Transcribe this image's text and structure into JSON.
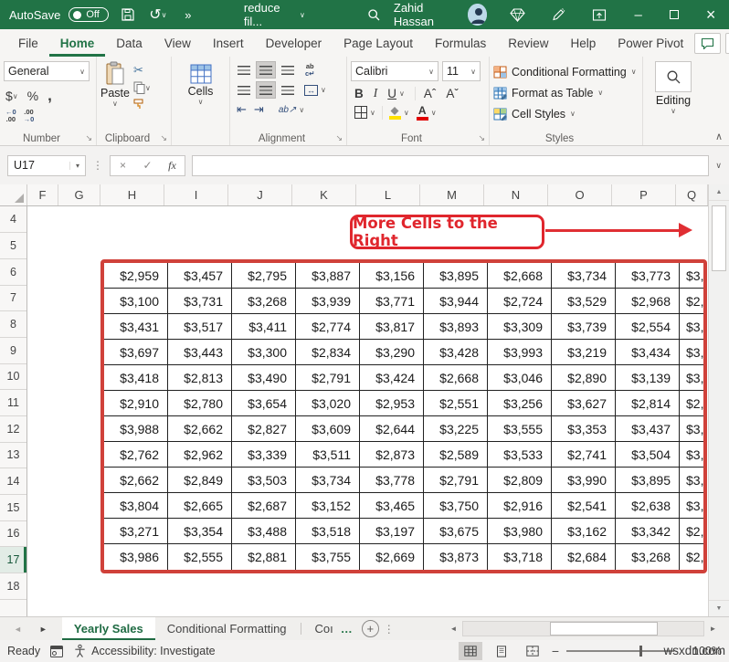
{
  "titlebar": {
    "autosave_label": "AutoSave",
    "autosave_state": "Off",
    "doc_name": "reduce fil...",
    "user_name": "Zahid Hassan",
    "bg_color": "#217346"
  },
  "icons": {
    "chevron_down": "∨",
    "overflow": "»",
    "undo": "↺",
    "dropdown": "▾",
    "dialog_launcher": "↘",
    "vertical_dots": "⋮",
    "scissors": "✂",
    "check": "✓",
    "close": "×",
    "minimize": "–",
    "collapse": "∧",
    "up_arrow": "▲",
    "down_arrow": "▼",
    "left_arrow": "◄",
    "right_arrow": "►",
    "add": "+",
    "ellipsis": "…",
    "fx": "fx",
    "merge_arrows": "↔",
    "indent_left": "⇤",
    "indent_right": "⇥",
    "orient_text": "ab↗",
    "wrap_top": "ab",
    "wrap_bot": "c↵",
    "dollar": "$",
    "percent": "%",
    "comma": ",",
    "minus": "−"
  },
  "ribbon": {
    "tabs": [
      {
        "label": "File",
        "active": false
      },
      {
        "label": "Home",
        "active": true
      },
      {
        "label": "Data",
        "active": false
      },
      {
        "label": "View",
        "active": false
      },
      {
        "label": "Insert",
        "active": false
      },
      {
        "label": "Developer",
        "active": false
      },
      {
        "label": "Page Layout",
        "active": false
      },
      {
        "label": "Formulas",
        "active": false
      },
      {
        "label": "Review",
        "active": false
      },
      {
        "label": "Help",
        "active": false
      },
      {
        "label": "Power Pivot",
        "active": false
      }
    ],
    "number": {
      "format": "General",
      "label": "Number",
      "dec1_top": "←0",
      "dec1_bot": ".00",
      "dec2_top": ".00",
      "dec2_bot": "→0"
    },
    "clipboard": {
      "paste": "Paste",
      "label": "Clipboard"
    },
    "cells": {
      "button": "Cells"
    },
    "alignment": {
      "label": "Alignment"
    },
    "font": {
      "family": "Calibri",
      "size": "11",
      "bold": "B",
      "italic": "I",
      "underline": "U",
      "grow": "Aˆ",
      "shrink": "Aˇ",
      "color_letter": "A",
      "label": "Font",
      "fill_color": "#ffe100",
      "font_color": "#e00000"
    },
    "styles": {
      "conditional_formatting": "Conditional Formatting",
      "format_as_table": "Format as Table",
      "cell_styles": "Cell Styles",
      "label": "Styles"
    },
    "editing": {
      "button": "Editing"
    }
  },
  "formula_bar": {
    "name_box": "U17",
    "formula": ""
  },
  "sheet": {
    "columns": [
      "F",
      "G",
      "H",
      "I",
      "J",
      "K",
      "L",
      "M",
      "N",
      "O",
      "P",
      "Q"
    ],
    "rows": [
      "4",
      "5",
      "6",
      "7",
      "8",
      "9",
      "10",
      "11",
      "12",
      "13",
      "14",
      "15",
      "16",
      "17",
      "18"
    ],
    "active_row": "17",
    "annotation": {
      "text": "More Cells to the Right",
      "color": "#e0262d"
    },
    "table": {
      "border_color": "#d0413a",
      "rows": [
        [
          "$2,959",
          "$3,457",
          "$2,795",
          "$3,887",
          "$3,156",
          "$3,895",
          "$2,668",
          "$3,734",
          "$3,773",
          "$3,"
        ],
        [
          "$3,100",
          "$3,731",
          "$3,268",
          "$3,939",
          "$3,771",
          "$3,944",
          "$2,724",
          "$3,529",
          "$2,968",
          "$2,"
        ],
        [
          "$3,431",
          "$3,517",
          "$3,411",
          "$2,774",
          "$3,817",
          "$3,893",
          "$3,309",
          "$3,739",
          "$2,554",
          "$3,"
        ],
        [
          "$3,697",
          "$3,443",
          "$3,300",
          "$2,834",
          "$3,290",
          "$3,428",
          "$3,993",
          "$3,219",
          "$3,434",
          "$3,"
        ],
        [
          "$3,418",
          "$2,813",
          "$3,490",
          "$2,791",
          "$3,424",
          "$2,668",
          "$3,046",
          "$2,890",
          "$3,139",
          "$3,"
        ],
        [
          "$2,910",
          "$2,780",
          "$3,654",
          "$3,020",
          "$2,953",
          "$2,551",
          "$3,256",
          "$3,627",
          "$2,814",
          "$2,"
        ],
        [
          "$3,988",
          "$2,662",
          "$2,827",
          "$3,609",
          "$2,644",
          "$3,225",
          "$3,555",
          "$3,353",
          "$3,437",
          "$3,"
        ],
        [
          "$2,762",
          "$2,962",
          "$3,339",
          "$3,511",
          "$2,873",
          "$2,589",
          "$3,533",
          "$2,741",
          "$3,504",
          "$3,"
        ],
        [
          "$2,662",
          "$2,849",
          "$3,503",
          "$3,734",
          "$3,778",
          "$2,791",
          "$2,809",
          "$3,990",
          "$3,895",
          "$3,"
        ],
        [
          "$3,804",
          "$2,665",
          "$2,687",
          "$3,152",
          "$3,465",
          "$3,750",
          "$2,916",
          "$2,541",
          "$2,638",
          "$3,"
        ],
        [
          "$3,271",
          "$3,354",
          "$3,488",
          "$3,518",
          "$3,197",
          "$3,675",
          "$3,980",
          "$3,162",
          "$3,342",
          "$2,"
        ],
        [
          "$3,986",
          "$2,555",
          "$2,881",
          "$3,755",
          "$2,669",
          "$3,873",
          "$3,718",
          "$2,684",
          "$3,268",
          "$2,"
        ]
      ]
    }
  },
  "sheet_tabs": {
    "tabs": [
      {
        "label": "Yearly Sales",
        "active": true
      },
      {
        "label": "Conditional Formatting",
        "active": false
      },
      {
        "label": "Coı",
        "active": false
      }
    ]
  },
  "status_bar": {
    "ready": "Ready",
    "accessibility": "Accessibility: Investigate",
    "zoom": "100%",
    "watermark": "wsxdn.com"
  }
}
